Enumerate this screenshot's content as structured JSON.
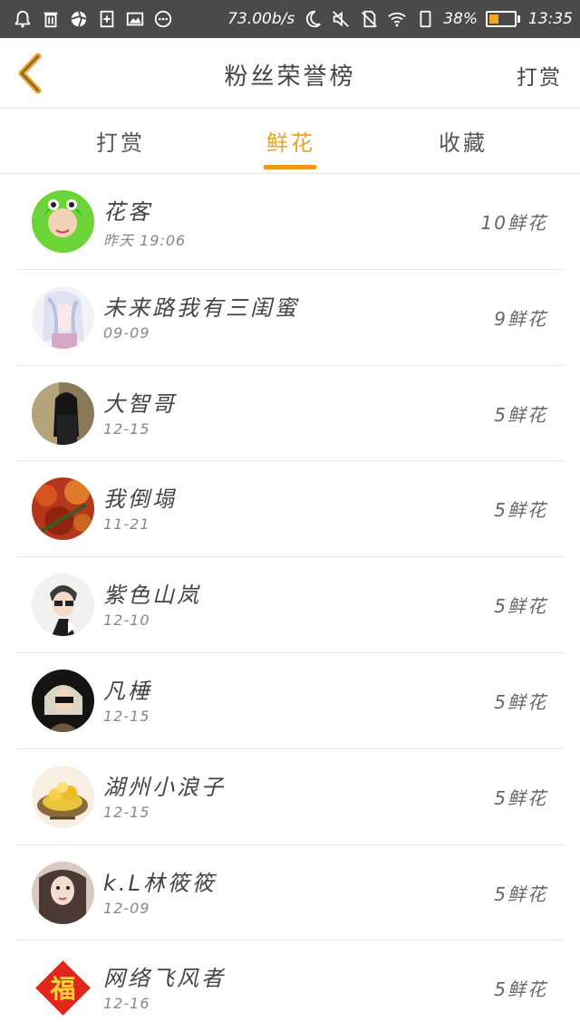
{
  "status_bar": {
    "icons": [
      "alarm-bell-icon",
      "trash-icon",
      "aperture-icon",
      "sim-add-icon",
      "gallery-icon",
      "more-dots-icon"
    ],
    "speed": "73.00b/s",
    "battery_percent": "38%",
    "battery_level": 0.38,
    "time": "13:35",
    "accent": "#f6a623"
  },
  "header": {
    "title": "粉丝荣誉榜",
    "action": "打赏"
  },
  "tabs": [
    {
      "label": "打赏",
      "active": false
    },
    {
      "label": "鲜花",
      "active": true
    },
    {
      "label": "收藏",
      "active": false
    }
  ],
  "colors": {
    "accent": "#eb9a13",
    "text": "#444444",
    "divider": "#e8e8e8"
  },
  "list": [
    {
      "name": "花客",
      "date": "昨天 19:06",
      "count": "10鲜花"
    },
    {
      "name": "未来路我有三闺蜜",
      "date": "09-09",
      "count": "9鲜花"
    },
    {
      "name": "大智哥",
      "date": "12-15",
      "count": "5鲜花"
    },
    {
      "name": "我倒塌",
      "date": "11-21",
      "count": "5鲜花"
    },
    {
      "name": "紫色山岚",
      "date": "12-10",
      "count": "5鲜花"
    },
    {
      "name": "凡棰",
      "date": "12-15",
      "count": "5鲜花"
    },
    {
      "name": "湖州小浪子",
      "date": "12-15",
      "count": "5鲜花"
    },
    {
      "name": "k.L林筱筱",
      "date": "12-09",
      "count": "5鲜花"
    },
    {
      "name": "网络飞风者",
      "date": "12-16",
      "count": "5鲜花",
      "avatar_text": "福"
    }
  ]
}
